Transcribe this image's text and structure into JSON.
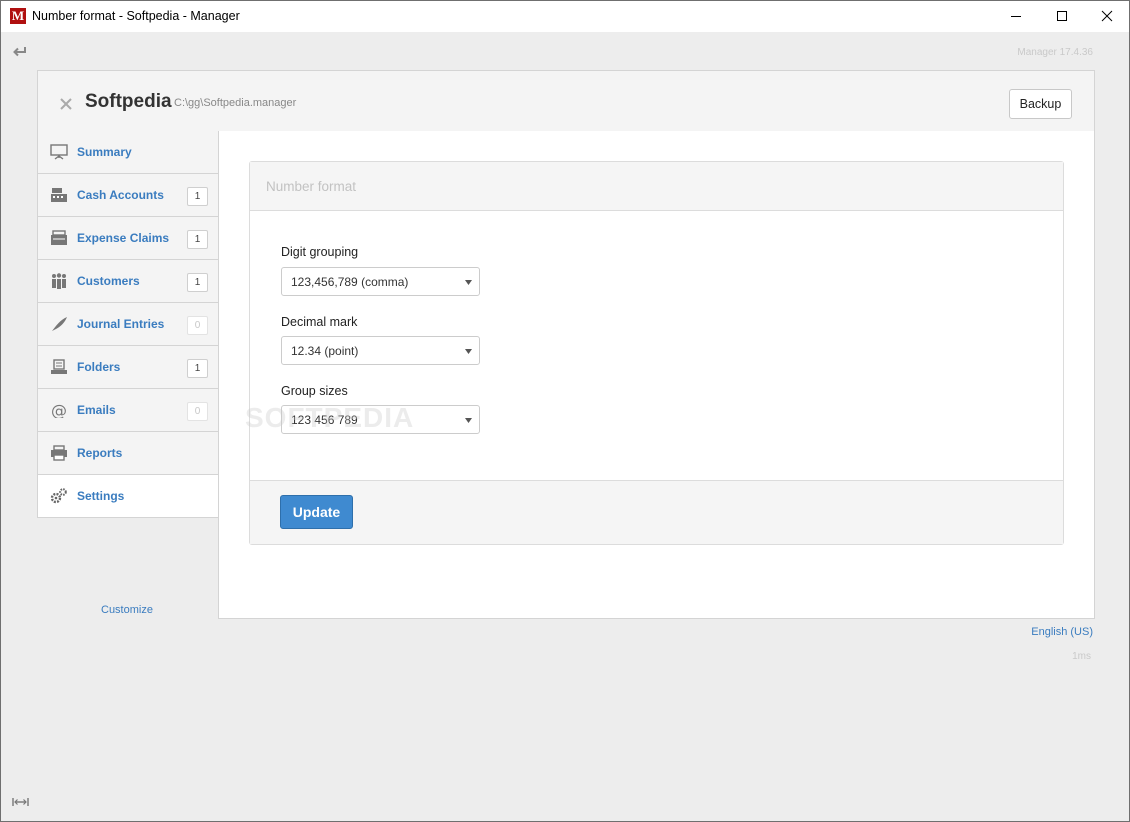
{
  "window": {
    "title": "Number format - Softpedia - Manager",
    "app_icon_letter": "M"
  },
  "header": {
    "version": "Manager 17.4.36",
    "company_name": "Softpedia",
    "company_path": "C:\\gg\\Softpedia.manager",
    "backup_label": "Backup"
  },
  "sidebar": {
    "items": [
      {
        "label": "Summary",
        "badge": "",
        "icon": "presentation-board-icon"
      },
      {
        "label": "Cash Accounts",
        "badge": "1",
        "icon": "cash-register-icon"
      },
      {
        "label": "Expense Claims",
        "badge": "1",
        "icon": "wallet-icon"
      },
      {
        "label": "Customers",
        "badge": "1",
        "icon": "people-icon"
      },
      {
        "label": "Journal Entries",
        "badge": "0",
        "icon": "quill-icon"
      },
      {
        "label": "Folders",
        "badge": "1",
        "icon": "file-tray-icon"
      },
      {
        "label": "Emails",
        "badge": "0",
        "icon": "at-sign-icon"
      },
      {
        "label": "Reports",
        "badge": "",
        "icon": "printer-icon"
      },
      {
        "label": "Settings",
        "badge": "",
        "icon": "gears-icon"
      }
    ],
    "customize_label": "Customize"
  },
  "form": {
    "title": "Number format",
    "digit_grouping": {
      "label": "Digit grouping",
      "value": "123,456,789 (comma)"
    },
    "decimal_mark": {
      "label": "Decimal mark",
      "value": "12.34 (point)"
    },
    "group_sizes": {
      "label": "Group sizes",
      "value": "123 456 789"
    },
    "update_label": "Update"
  },
  "watermark": "SOFTPEDIA",
  "footer": {
    "language": "English (US)",
    "timing": "1ms"
  },
  "colors": {
    "accent": "#3a7cbf",
    "button_primary": "#3f8ad0",
    "app_icon": "#b01010"
  }
}
